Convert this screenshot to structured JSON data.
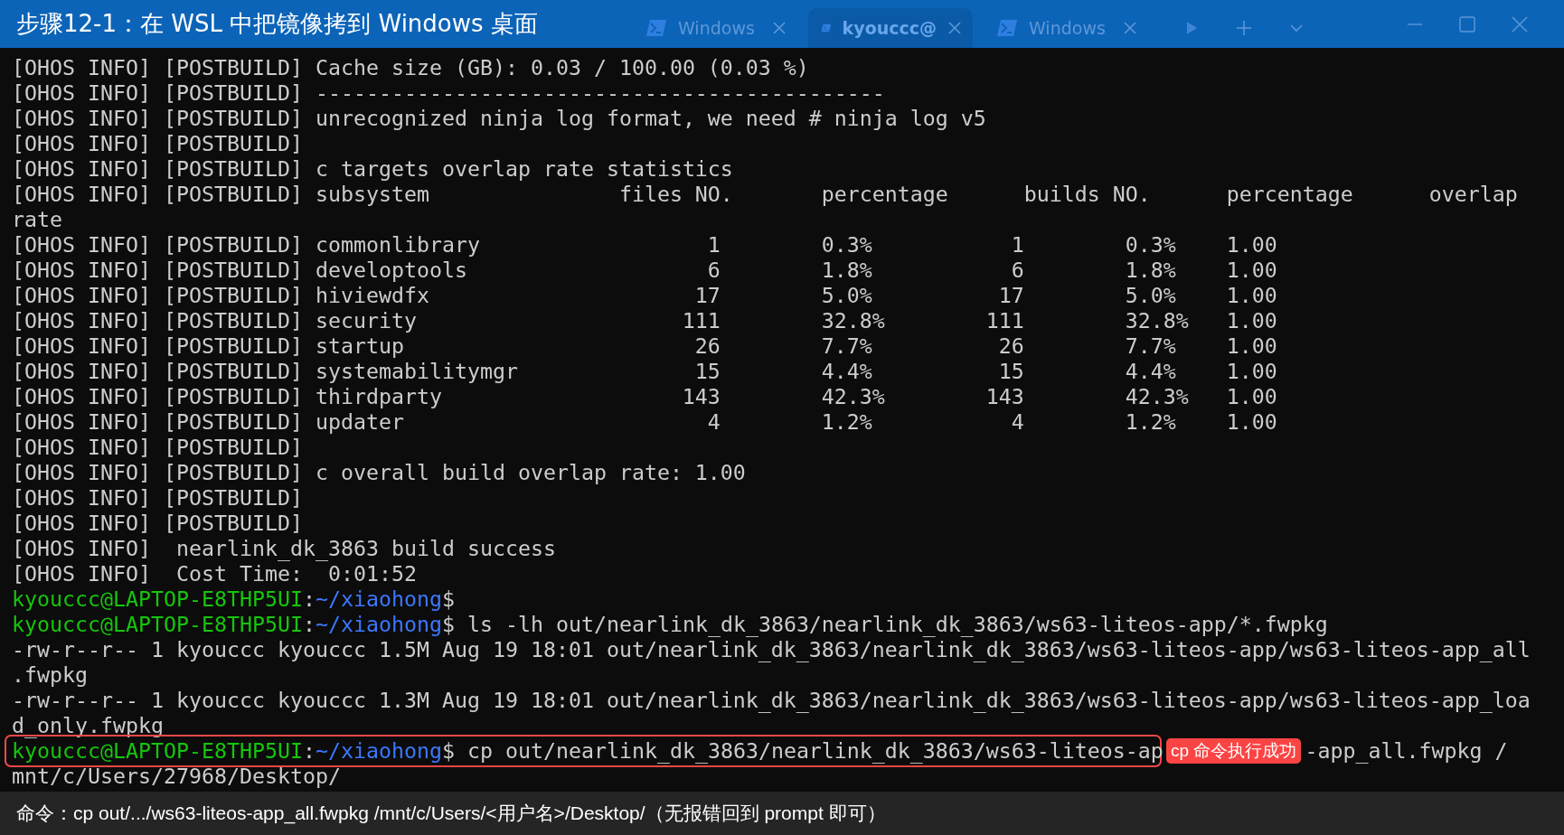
{
  "title": "步骤12-1：在 WSL 中把镜像拷到 Windows 桌面",
  "tabs": [
    {
      "label": "Windows",
      "selected": false
    },
    {
      "label": "kyouccc@",
      "selected": true
    },
    {
      "label": "Windows",
      "selected": false
    }
  ],
  "terminal": {
    "lines": [
      {
        "kind": "text",
        "text": "[OHOS INFO] [POSTBUILD] Cache size (GB): 0.03 / 100.00 (0.03 %)"
      },
      {
        "kind": "text",
        "text": "[OHOS INFO] [POSTBUILD] ---------------------------------------------"
      },
      {
        "kind": "text",
        "text": "[OHOS INFO] [POSTBUILD] unrecognized ninja log format, we need # ninja log v5"
      },
      {
        "kind": "text",
        "text": "[OHOS INFO] [POSTBUILD]"
      },
      {
        "kind": "text",
        "text": "[OHOS INFO] [POSTBUILD] c targets overlap rate statistics"
      },
      {
        "kind": "text",
        "text": "[OHOS INFO] [POSTBUILD] subsystem               files NO.       percentage      builds NO.      percentage      overlap"
      },
      {
        "kind": "text",
        "text": "rate"
      },
      {
        "kind": "row",
        "prefix": "[OHOS INFO] [POSTBUILD]",
        "cells": [
          "commonlibrary",
          "1",
          "0.3%",
          "1",
          "0.3%",
          "1.00"
        ]
      },
      {
        "kind": "row",
        "prefix": "[OHOS INFO] [POSTBUILD]",
        "cells": [
          "developtools",
          "6",
          "1.8%",
          "6",
          "1.8%",
          "1.00"
        ]
      },
      {
        "kind": "row",
        "prefix": "[OHOS INFO] [POSTBUILD]",
        "cells": [
          "hiviewdfx",
          "17",
          "5.0%",
          "17",
          "5.0%",
          "1.00"
        ]
      },
      {
        "kind": "row",
        "prefix": "[OHOS INFO] [POSTBUILD]",
        "cells": [
          "security",
          "111",
          "32.8%",
          "111",
          "32.8%",
          "1.00"
        ]
      },
      {
        "kind": "row",
        "prefix": "[OHOS INFO] [POSTBUILD]",
        "cells": [
          "startup",
          "26",
          "7.7%",
          "26",
          "7.7%",
          "1.00"
        ]
      },
      {
        "kind": "row",
        "prefix": "[OHOS INFO] [POSTBUILD]",
        "cells": [
          "systemabilitymgr",
          "15",
          "4.4%",
          "15",
          "4.4%",
          "1.00"
        ]
      },
      {
        "kind": "row",
        "prefix": "[OHOS INFO] [POSTBUILD]",
        "cells": [
          "thirdparty",
          "143",
          "42.3%",
          "143",
          "42.3%",
          "1.00"
        ]
      },
      {
        "kind": "row",
        "prefix": "[OHOS INFO] [POSTBUILD]",
        "cells": [
          "updater",
          "4",
          "1.2%",
          "4",
          "1.2%",
          "1.00"
        ]
      },
      {
        "kind": "text",
        "text": "[OHOS INFO] [POSTBUILD]"
      },
      {
        "kind": "text",
        "text": "[OHOS INFO] [POSTBUILD] c overall build overlap rate: 1.00"
      },
      {
        "kind": "text",
        "text": "[OHOS INFO] [POSTBUILD]"
      },
      {
        "kind": "text",
        "text": "[OHOS INFO] [POSTBUILD]"
      },
      {
        "kind": "text",
        "text": "[OHOS INFO]  nearlink_dk_3863 build success"
      },
      {
        "kind": "text",
        "text": "[OHOS INFO]  Cost Time:  0:01:52"
      },
      {
        "kind": "prompt",
        "segments": [
          {
            "text": "kyouccc@LAPTOP-E8THP5UI",
            "color": "#16c60c"
          },
          {
            "text": ":",
            "color": "#cccccc"
          },
          {
            "text": "~/xiaohong",
            "color": "#3b78ff"
          },
          {
            "text": "$",
            "color": "#cccccc"
          }
        ]
      },
      {
        "kind": "prompt",
        "segments": [
          {
            "text": "kyouccc@LAPTOP-E8THP5UI",
            "color": "#16c60c"
          },
          {
            "text": ":",
            "color": "#cccccc"
          },
          {
            "text": "~/xiaohong",
            "color": "#3b78ff"
          },
          {
            "text": "$",
            "color": "#cccccc"
          }
        ],
        "command": "ls -lh out/nearlink_dk_3863/nearlink_dk_3863/ws63-liteos-app/*.fwpkg"
      },
      {
        "kind": "text",
        "text": "-rw-r--r-- 1 kyouccc kyouccc 1.5M Aug 19 18:01 out/nearlink_dk_3863/nearlink_dk_3863/ws63-liteos-app/ws63-liteos-app_all"
      },
      {
        "kind": "text",
        "text": ".fwpkg"
      },
      {
        "kind": "text",
        "text": "-rw-r--r-- 1 kyouccc kyouccc 1.3M Aug 19 18:01 out/nearlink_dk_3863/nearlink_dk_3863/ws63-liteos-app/ws63-liteos-app_loa"
      },
      {
        "kind": "text",
        "text": "d_only.fwpkg"
      },
      {
        "kind": "prompt",
        "highlighted": true,
        "segments": [
          {
            "text": "kyouccc@LAPTOP-E8THP5UI",
            "color": "#16c60c"
          },
          {
            "text": ":",
            "color": "#cccccc"
          },
          {
            "text": "~/xiaohong",
            "color": "#3b78ff"
          },
          {
            "text": "$",
            "color": "#cccccc"
          }
        ],
        "command": "cp out/nearlink_dk_3863/nearlink_dk_3863/ws63-liteos-ap",
        "badge": "cp 命令执行成功",
        "command_rest": "-app_all.fwpkg /"
      },
      {
        "kind": "text",
        "text": "mnt/c/Users/27968/Desktop/"
      }
    ]
  },
  "caption": "命令：cp out/.../ws63-liteos-app_all.fwpkg /mnt/c/Users/<用户名>/Desktop/（无报错回到 prompt 即可）"
}
